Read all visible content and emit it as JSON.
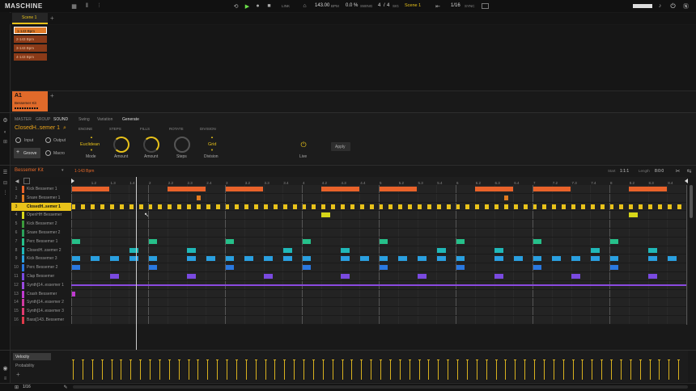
{
  "app": {
    "logo": "MASCHINE"
  },
  "transport": {
    "link": "LINK",
    "tempo": "143.00",
    "tempo_unit": "BPM",
    "swing": "0.0 %",
    "swing_label": "SWING",
    "sig_num": "4",
    "sig_sep": "/",
    "sig_den": "4",
    "sig_label": "SIG",
    "scene": "Scene 1",
    "grid": "1/16",
    "sync": "SYNC"
  },
  "arranger": {
    "scene_tab": "Scene 1",
    "add": "+",
    "patterns": [
      "1-143 Bpm",
      "2-143 Bpm",
      "3-143 Bpm",
      "4-143 Bpm"
    ]
  },
  "group": {
    "slot": "A1",
    "name": "Bessemer Kit",
    "add": "+"
  },
  "control": {
    "tabs": [
      "MASTER",
      "GROUP",
      "SOUND"
    ],
    "sound_name": "ClosedH..semer 1",
    "input": "Input",
    "output": "Output",
    "groove": "Groove",
    "macro": "Macro",
    "subtabs": [
      "Swing",
      "Variation",
      "Generate"
    ],
    "sections": [
      "ENGINE",
      "STEPS",
      "FILLS",
      "ROTATE",
      "DIVISION"
    ],
    "engine_value": "Euclidean",
    "engine_label": "Mode",
    "steps_label": "Amount",
    "fills_label": "Amount",
    "rotate_label": "Steps",
    "division_value": "Grid",
    "division_label": "Division",
    "live_label": "Live",
    "apply": "Apply"
  },
  "pattern_editor": {
    "group_name": "Bessemer Kit",
    "pattern_name": "1-143 Bpm",
    "start_label": "Start",
    "start_value": "1:1:1",
    "length_label": "Length",
    "length_value": "8:0:0",
    "ruler": [
      "1.2",
      "1.3",
      "1.4",
      "2",
      "2.2",
      "2.3",
      "2.4",
      "3",
      "3.2",
      "3.3",
      "3.4",
      "4",
      "4.2",
      "4.3",
      "4.4",
      "5",
      "5.2",
      "5.3",
      "5.4",
      "6",
      "6.2",
      "6.3",
      "6.4",
      "7",
      "7.2",
      "7.3",
      "7.4",
      "8",
      "8.2",
      "8.3",
      "8.4"
    ],
    "sounds": [
      {
        "num": "1",
        "name": "Kick Bessemer 1",
        "color": "#e8622a"
      },
      {
        "num": "2",
        "name": "Snare Bessemer 1",
        "color": "#e07a20"
      },
      {
        "num": "3",
        "name": "ClosedH..semer 1",
        "color": "#e8c21a"
      },
      {
        "num": "4",
        "name": "OpenHH Bessemer",
        "color": "#d6d619"
      },
      {
        "num": "5",
        "name": "Kick Bessemer 2",
        "color": "#3a9a3a"
      },
      {
        "num": "6",
        "name": "Snare Bessemer 2",
        "color": "#2aa05a"
      },
      {
        "num": "7",
        "name": "Perc Bessemer 1",
        "color": "#26c08a"
      },
      {
        "num": "8",
        "name": "ClosedH..ssemer 2",
        "color": "#20b8b8"
      },
      {
        "num": "9",
        "name": "Kick Bessemer 3",
        "color": "#2aa0e0"
      },
      {
        "num": "10",
        "name": "Perc Bessemer 2",
        "color": "#2a78e0"
      },
      {
        "num": "11",
        "name": "Clap Bessemer",
        "color": "#7a4ae0"
      },
      {
        "num": "12",
        "name": "Synth[14..essemer 1",
        "color": "#9a4ae0"
      },
      {
        "num": "13",
        "name": "Crash Bessemer",
        "color": "#c03ad0"
      },
      {
        "num": "14",
        "name": "Synth[14..essemer 2",
        "color": "#d03aa0"
      },
      {
        "num": "15",
        "name": "Synth[14..essemer 3",
        "color": "#e03a70"
      },
      {
        "num": "16",
        "name": "Bass[143..Bessemer",
        "color": "#e03a4a"
      }
    ]
  },
  "lanes": {
    "items": [
      "Velocity",
      "Probability"
    ],
    "add": "+"
  },
  "footer": {
    "grid": "1/16"
  },
  "icons": {
    "logo": "maschine-logo",
    "browser": "browser-icon",
    "mixer": "mixer-icon",
    "play": "play-icon",
    "record": "record-icon",
    "stop": "stop-icon",
    "power": "power-icon"
  }
}
